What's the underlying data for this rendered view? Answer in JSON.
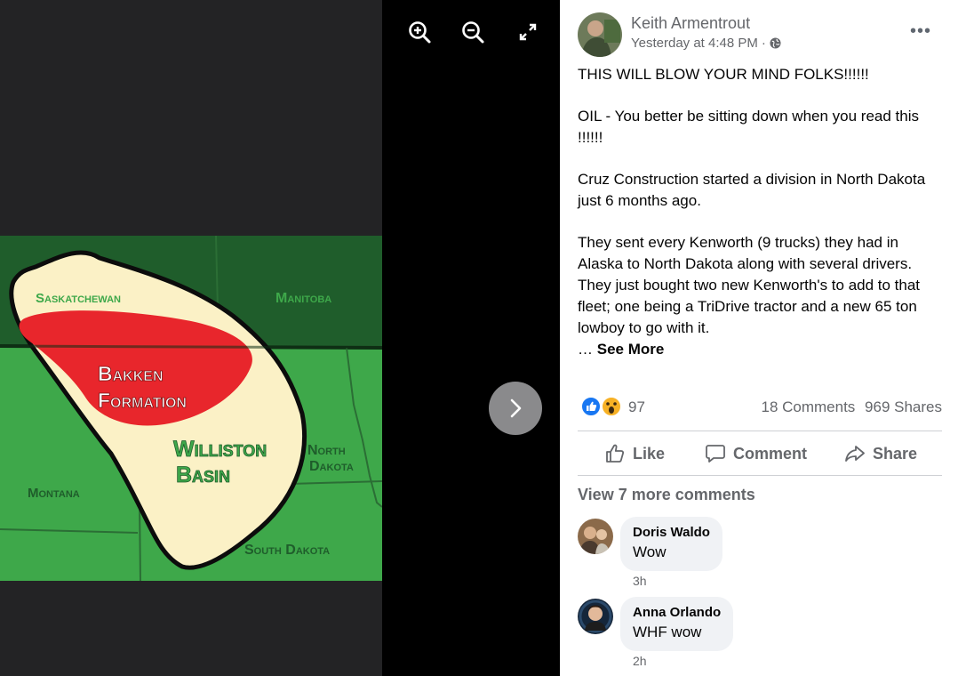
{
  "viewer": {
    "map_labels": {
      "saskatchewan": "Saskatchewan",
      "manitoba": "Manitoba",
      "bakken_1": "Bakken",
      "bakken_2": "Formation",
      "williston_1": "Williston",
      "williston_2": "Basin",
      "north_dakota_1": "North",
      "north_dakota_2": "Dakota",
      "montana": "Montana",
      "south_dakota": "South Dakota"
    },
    "toolbar_icons": [
      "zoom-in-icon",
      "zoom-out-icon",
      "fullscreen-icon"
    ],
    "next_icon": "chevron-right-icon"
  },
  "post": {
    "author": "Keith Armentrout",
    "timestamp": "Yesterday at 4:48 PM",
    "separator": "·",
    "privacy_icon": "globe-icon",
    "more_label": "•••",
    "paragraphs": [
      "THIS WILL BLOW YOUR MIND FOLKS!!!!!!",
      "OIL - You better be sitting down when you read this !!!!!!",
      "Cruz Construction started a division in North Dakota just 6 months ago.",
      "They sent every Kenworth (9 trucks) they had in Alaska to North Dakota along with several drivers. They just bought two new Kenworth's to add to that fleet; one being a TriDrive tractor and a new 65 ton lowboy to go with it."
    ],
    "ellipsis": "… ",
    "see_more": "See More",
    "reaction_count": "97",
    "comments_count": "18 Comments",
    "shares_count": "969 Shares",
    "actions": {
      "like": "Like",
      "comment": "Comment",
      "share": "Share"
    },
    "view_more_comments": "View 7 more comments",
    "comments": [
      {
        "author": "Doris Waldo",
        "text": "Wow",
        "time": "3h"
      },
      {
        "author": "Anna Orlando",
        "text": "WHF wow",
        "time": "2h"
      }
    ]
  },
  "colors": {
    "like_blue": "#1877f2",
    "map_dark_green": "#1f5d2b",
    "map_green": "#3ea84a",
    "map_cream": "#fbf1c6",
    "map_red": "#e8262c"
  }
}
